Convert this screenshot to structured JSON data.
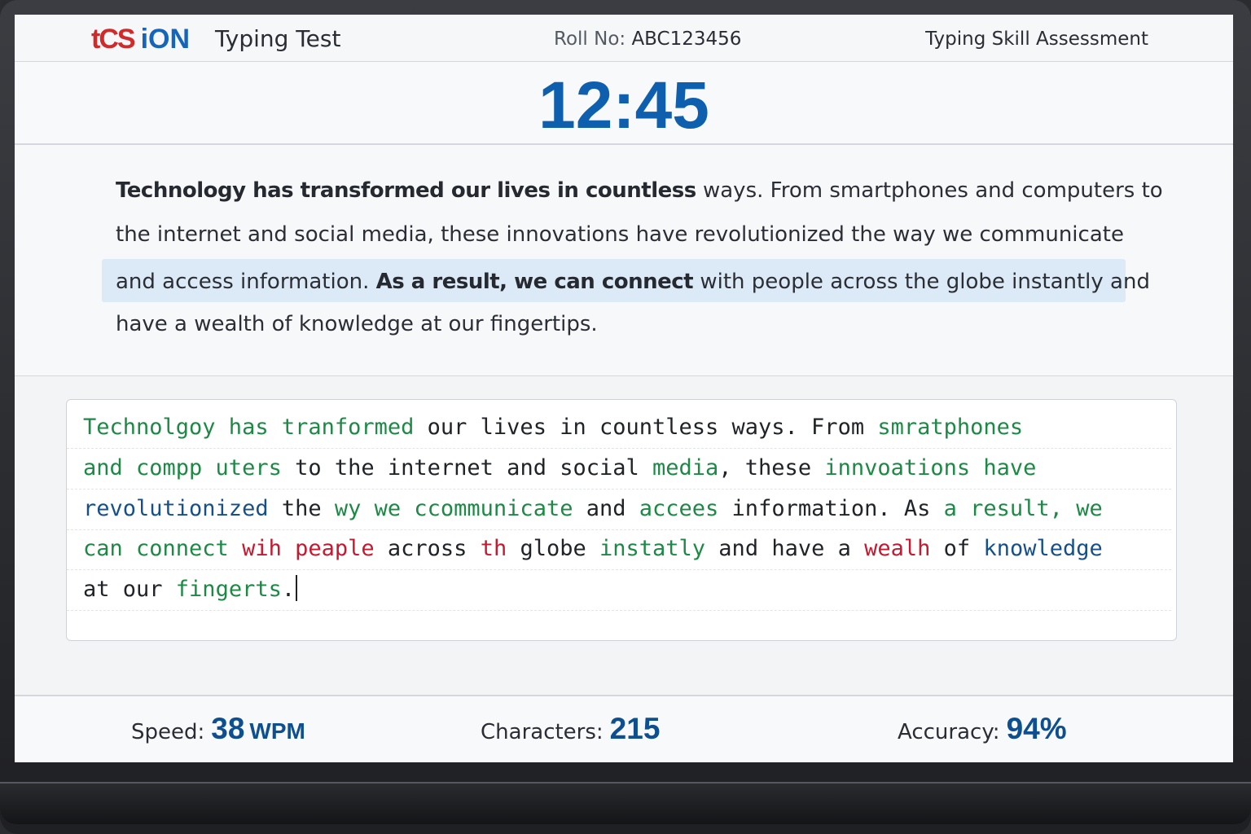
{
  "header": {
    "logo_tcs": "tCS",
    "logo_ion": "iON",
    "title": "Typing Test",
    "roll_label": "Roll No:",
    "roll_value": "ABC123456",
    "assessment": "Typing Skill Assessment"
  },
  "timer": "12:45",
  "passage": {
    "lines": [
      [
        {
          "text": "Technology has transformed our lives in countless",
          "style": "bold"
        },
        {
          "text": " ways. From smartphones and computers to",
          "style": "normal"
        }
      ],
      [
        {
          "text": "the internet and social media, these innovations have revolutionized the way we communicate",
          "style": "normal"
        }
      ],
      [
        {
          "text": "and access information. ",
          "style": "normal"
        },
        {
          "text": "As a result, we can connect",
          "style": "bold"
        },
        {
          "text": " with people across the globe instantly and",
          "style": "normal"
        }
      ],
      [
        {
          "text": "have a wealth of knowledge at our fingertips.",
          "style": "normal"
        }
      ]
    ],
    "highlighted_line": 2
  },
  "typed": {
    "lines": [
      [
        {
          "t": "Technolgoy has tranformed",
          "c": "g"
        },
        {
          "t": " our lives in countless ways. From ",
          "c": "k"
        },
        {
          "t": "smratphones",
          "c": "g"
        }
      ],
      [
        {
          "t": "and compp uters",
          "c": "g"
        },
        {
          "t": " to the internet and social ",
          "c": "k"
        },
        {
          "t": "media",
          "c": "g"
        },
        {
          "t": ", these ",
          "c": "k"
        },
        {
          "t": "innvoations have",
          "c": "g"
        }
      ],
      [
        {
          "t": "revolutionized",
          "c": "bl"
        },
        {
          "t": " the ",
          "c": "k"
        },
        {
          "t": "wy we ccommunicate",
          "c": "g"
        },
        {
          "t": " and ",
          "c": "k"
        },
        {
          "t": "accees",
          "c": "g"
        },
        {
          "t": " information. As ",
          "c": "k"
        },
        {
          "t": "a result, we",
          "c": "g"
        }
      ],
      [
        {
          "t": "can connect ",
          "c": "g"
        },
        {
          "t": "wih peaple",
          "c": "r"
        },
        {
          "t": " across ",
          "c": "k"
        },
        {
          "t": "th",
          "c": "r"
        },
        {
          "t": " globe ",
          "c": "k"
        },
        {
          "t": "instatly",
          "c": "g"
        },
        {
          "t": " and have a ",
          "c": "k"
        },
        {
          "t": "wealh",
          "c": "r"
        },
        {
          "t": " of ",
          "c": "k"
        },
        {
          "t": "knowledge",
          "c": "bl"
        }
      ],
      [
        {
          "t": "at our ",
          "c": "k"
        },
        {
          "t": "fingerts",
          "c": "g"
        },
        {
          "t": ".",
          "c": "k"
        }
      ]
    ]
  },
  "stats": {
    "speed_label": "Speed:",
    "speed_value": "38",
    "speed_unit": "WPM",
    "chars_label": "Characters:",
    "chars_value": "215",
    "accuracy_label": "Accuracy:",
    "accuracy_value": "94%"
  },
  "colors": {
    "accent": "#0e5fae",
    "correct": "#1c8a45",
    "error": "#c6182f",
    "highlight": "#dce9f7"
  }
}
